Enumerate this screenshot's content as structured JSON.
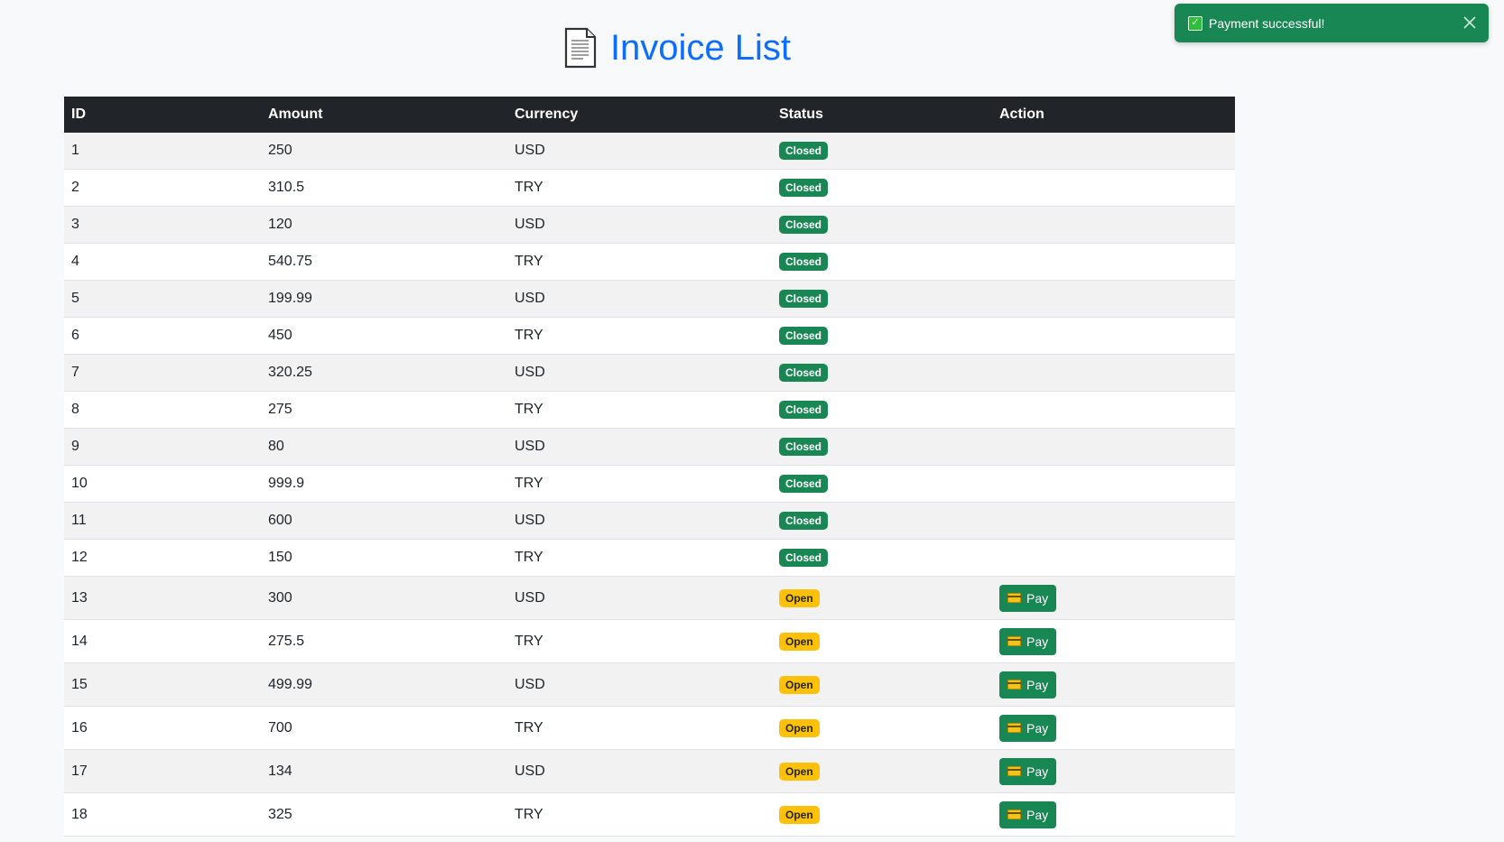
{
  "title": "Invoice List",
  "icons": {
    "title_icon": "document-icon",
    "pay_icon": "credit-card-icon",
    "toast_icon": "check-icon",
    "toast_close_icon": "close-icon"
  },
  "colors": {
    "title": "#0d6efd",
    "header_bg": "#212529",
    "closed_badge": "#198754",
    "open_badge": "#ffc107",
    "pay_button": "#198754",
    "toast_bg": "#198754"
  },
  "toast": {
    "message": "Payment successful!"
  },
  "table": {
    "columns": [
      "ID",
      "Amount",
      "Currency",
      "Status",
      "Action"
    ],
    "pay_label": "Pay",
    "rows": [
      {
        "id": "1",
        "amount": "250",
        "currency": "USD",
        "status": "Closed"
      },
      {
        "id": "2",
        "amount": "310.5",
        "currency": "TRY",
        "status": "Closed"
      },
      {
        "id": "3",
        "amount": "120",
        "currency": "USD",
        "status": "Closed"
      },
      {
        "id": "4",
        "amount": "540.75",
        "currency": "TRY",
        "status": "Closed"
      },
      {
        "id": "5",
        "amount": "199.99",
        "currency": "USD",
        "status": "Closed"
      },
      {
        "id": "6",
        "amount": "450",
        "currency": "TRY",
        "status": "Closed"
      },
      {
        "id": "7",
        "amount": "320.25",
        "currency": "USD",
        "status": "Closed"
      },
      {
        "id": "8",
        "amount": "275",
        "currency": "TRY",
        "status": "Closed"
      },
      {
        "id": "9",
        "amount": "80",
        "currency": "USD",
        "status": "Closed"
      },
      {
        "id": "10",
        "amount": "999.9",
        "currency": "TRY",
        "status": "Closed"
      },
      {
        "id": "11",
        "amount": "600",
        "currency": "USD",
        "status": "Closed"
      },
      {
        "id": "12",
        "amount": "150",
        "currency": "TRY",
        "status": "Closed"
      },
      {
        "id": "13",
        "amount": "300",
        "currency": "USD",
        "status": "Open"
      },
      {
        "id": "14",
        "amount": "275.5",
        "currency": "TRY",
        "status": "Open"
      },
      {
        "id": "15",
        "amount": "499.99",
        "currency": "USD",
        "status": "Open"
      },
      {
        "id": "16",
        "amount": "700",
        "currency": "TRY",
        "status": "Open"
      },
      {
        "id": "17",
        "amount": "134",
        "currency": "USD",
        "status": "Open"
      },
      {
        "id": "18",
        "amount": "325",
        "currency": "TRY",
        "status": "Open"
      }
    ]
  }
}
